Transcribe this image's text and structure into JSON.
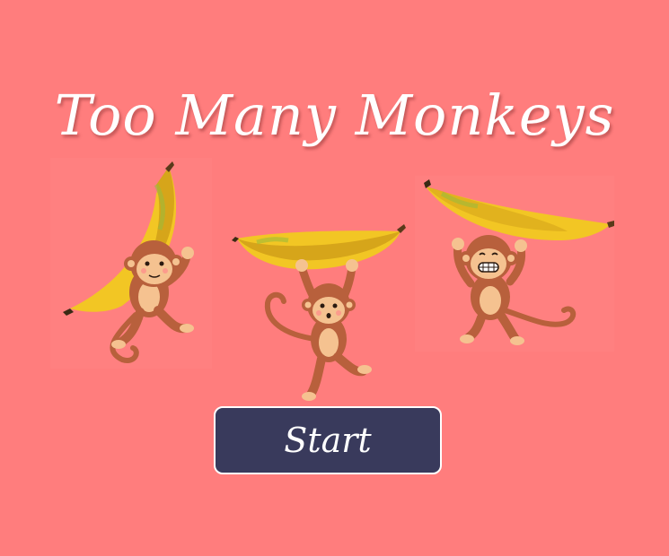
{
  "game": {
    "title": "Too Many Monkeys",
    "start_label": "Start"
  },
  "colors": {
    "background": "#ff7d7d",
    "title_text": "#ffffff",
    "button_background": "#393a5c",
    "button_border": "#ffffff",
    "banana_yellow": "#f2c624",
    "monkey_brown": "#b8603c",
    "monkey_face": "#f5c290"
  },
  "sprites": [
    {
      "name": "monkey-hugging-banana",
      "expression": "smile"
    },
    {
      "name": "monkey-hanging-from-banana",
      "expression": "surprised"
    },
    {
      "name": "monkey-carrying-banana",
      "expression": "grin"
    }
  ]
}
